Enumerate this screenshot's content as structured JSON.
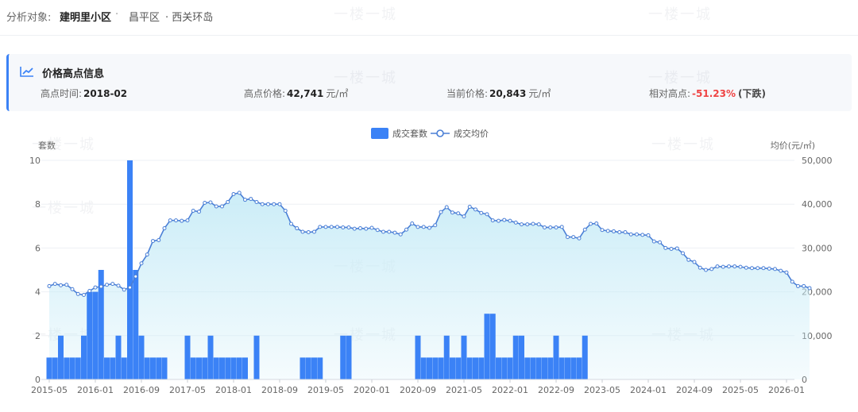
{
  "header": {
    "label": "分析对象:",
    "community": "建明里小区",
    "separator": "·",
    "district": "昌平区",
    "area": "· 西关环岛"
  },
  "peak": {
    "title": "价格高点信息",
    "time_label": "高点时间:",
    "time_value": "2018-02",
    "peak_price_label": "高点价格:",
    "peak_price_value": "42,741",
    "unit": "元/㎡",
    "current_price_label": "当前价格:",
    "current_price_value": "20,843",
    "relative_label": "相对高点:",
    "relative_value": "-51.23%",
    "relative_hint": "(下跌)"
  },
  "watermark": "一楼一城",
  "colors": {
    "bar": "#3b82f6",
    "line": "#4a7fd6",
    "area_top": "#c9ecf7",
    "accent": "#3b82f6",
    "negative": "#ef4444"
  },
  "chart_data": {
    "type": "bar+line",
    "legend_placement": "top-center",
    "legend": [
      "成交套数",
      "成交均价"
    ],
    "left_axis_label": "套数",
    "right_axis_label": "均价(元/㎡)",
    "left_ticks": [
      "0",
      "2",
      "4",
      "6",
      "8",
      "10"
    ],
    "right_ticks": [
      "0",
      "10,000",
      "20,000",
      "30,000",
      "40,000",
      "50,000"
    ],
    "ylim_left": [
      0,
      10
    ],
    "ylim_right": [
      0,
      50000
    ],
    "x_ticks": [
      "2015-05",
      "2016-01",
      "2016-09",
      "2017-05",
      "2018-01",
      "2018-09",
      "2019-05",
      "2020-01",
      "2020-09",
      "2021-05",
      "2022-01",
      "2022-09",
      "2023-05",
      "2024-01",
      "2024-09",
      "2025-05",
      "2026-01"
    ],
    "start_month": "2015-05",
    "series": [
      {
        "name": "成交套数",
        "type": "bar",
        "values": [
          1,
          1,
          2,
          1,
          1,
          1,
          2,
          4,
          4,
          5,
          1,
          1,
          2,
          1,
          10,
          5,
          2,
          1,
          1,
          1,
          1,
          0,
          0,
          0,
          2,
          1,
          1,
          1,
          2,
          1,
          1,
          1,
          1,
          1,
          1,
          0,
          2,
          0,
          0,
          0,
          0,
          0,
          0,
          0,
          1,
          1,
          1,
          1,
          0,
          0,
          0,
          2,
          2,
          0,
          0,
          0,
          0,
          0,
          0,
          0,
          0,
          0,
          0,
          0,
          2,
          1,
          1,
          1,
          1,
          2,
          1,
          1,
          2,
          1,
          1,
          1,
          3,
          3,
          1,
          1,
          1,
          2,
          2,
          1,
          1,
          1,
          1,
          1,
          2,
          1,
          1,
          1,
          1,
          2,
          0,
          0,
          0,
          0,
          0,
          0,
          0,
          0,
          0,
          0,
          0,
          0,
          0,
          0,
          0,
          0,
          0,
          0,
          0,
          0,
          0,
          0,
          0,
          0,
          0,
          0,
          0,
          0,
          0,
          0,
          0,
          0,
          0,
          0,
          0,
          0,
          0
        ]
      },
      {
        "name": "成交均价",
        "type": "line",
        "values": [
          21300,
          21800,
          21500,
          21600,
          20600,
          19500,
          19300,
          20200,
          21000,
          21200,
          21600,
          21800,
          21400,
          20500,
          21000,
          23500,
          26500,
          28500,
          31600,
          31800,
          34500,
          36300,
          36300,
          36200,
          36300,
          38500,
          38300,
          40300,
          40400,
          39500,
          39500,
          40500,
          42300,
          42600,
          41000,
          41200,
          40500,
          40000,
          40000,
          40000,
          40000,
          38500,
          35500,
          34500,
          33700,
          33600,
          33700,
          34800,
          34800,
          34800,
          34800,
          34700,
          34700,
          34400,
          34500,
          34400,
          34600,
          34100,
          33700,
          33700,
          33500,
          33100,
          34200,
          35600,
          34800,
          34800,
          34600,
          35200,
          38200,
          39300,
          38100,
          37900,
          37200,
          39400,
          38800,
          38000,
          37700,
          36300,
          36200,
          36400,
          36200,
          35800,
          35400,
          35400,
          35500,
          35400,
          34700,
          34700,
          34700,
          34800,
          32500,
          32500,
          32200,
          34200,
          35500,
          35600,
          34100,
          33900,
          33800,
          33600,
          33600,
          33100,
          33100,
          33000,
          32900,
          31500,
          31300,
          30000,
          29800,
          29900,
          28800,
          27300,
          26800,
          25500,
          25000,
          25200,
          25800,
          25700,
          25800,
          25800,
          25700,
          25500,
          25400,
          25400,
          25400,
          25300,
          25200,
          24800,
          24400,
          22300,
          21300,
          21300,
          20843
        ]
      }
    ]
  }
}
